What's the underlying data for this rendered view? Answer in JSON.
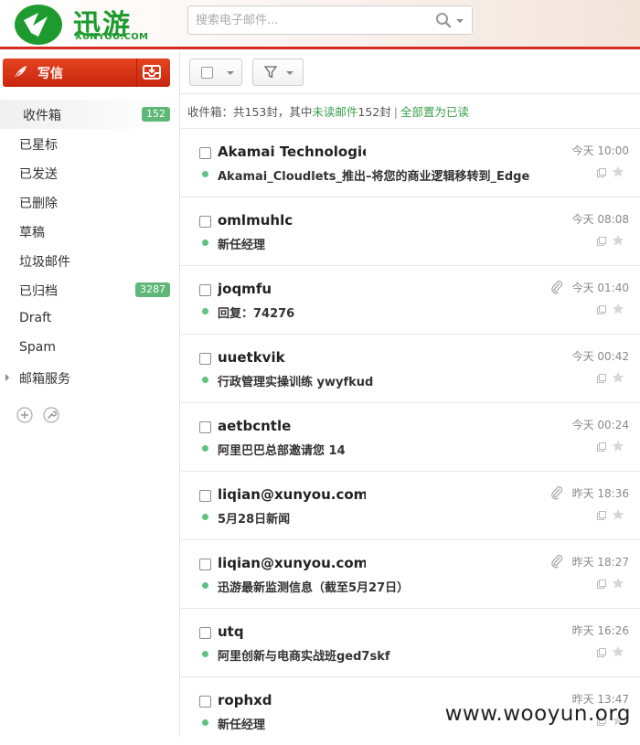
{
  "header": {
    "logo_text": "迅游",
    "logo_sub": "XUNYOU.COM",
    "search_placeholder": "搜索电子邮件..."
  },
  "sidebar": {
    "compose_label": "写信",
    "items": [
      {
        "label": "收件箱",
        "count": "152",
        "active": true
      },
      {
        "label": "已星标"
      },
      {
        "label": "已发送"
      },
      {
        "label": "已删除"
      },
      {
        "label": "草稿"
      },
      {
        "label": "垃圾邮件"
      },
      {
        "label": "已归档",
        "count": "3287"
      },
      {
        "label": "Draft"
      },
      {
        "label": "Spam"
      },
      {
        "label": "邮箱服务",
        "expandable": true
      }
    ]
  },
  "summary": {
    "prefix": "收件箱：共153封，其中",
    "unread_link": "未读邮件",
    "unread_count": "152封",
    "separator": "|",
    "mark_all_read": "全部置为已读"
  },
  "mails": [
    {
      "from": "Akamai Technologies",
      "time": "今天 10:00",
      "subject": "Akamai_Cloudlets_推出–将您的商业逻辑移转到_Edge",
      "attachment": false
    },
    {
      "from": "omlmuhlc",
      "time": "今天 08:08",
      "subject": "新任经理",
      "attachment": false
    },
    {
      "from": "joqmfu",
      "time": "今天 01:40",
      "subject": "回复：74276",
      "attachment": true
    },
    {
      "from": "uuetkvik",
      "time": "今天 00:42",
      "subject": "行政管理实操训练 ywyfkud",
      "attachment": false
    },
    {
      "from": "aetbcntle",
      "time": "今天 00:24",
      "subject": "阿里巴巴总部邀请您 14",
      "attachment": false
    },
    {
      "from": "liqian@xunyou.com",
      "time": "昨天 18:36",
      "subject": "5月28日新闻",
      "attachment": true
    },
    {
      "from": "liqian@xunyou.com",
      "time": "昨天 18:27",
      "subject": "迅游最新监测信息（截至5月27日）",
      "attachment": true
    },
    {
      "from": "utq",
      "time": "昨天 16:26",
      "subject": "阿里创新与电商实战班ged7skf",
      "attachment": false
    },
    {
      "from": "rophxd",
      "time": "昨天 13:47",
      "subject": "新任经理",
      "attachment": false
    }
  ],
  "watermark": "www.wooyun.org",
  "colors": {
    "brand_green": "#1d9b2f",
    "accent_red": "#d42b1e",
    "unread_dot": "#62c082",
    "badge": "#5fb878"
  }
}
